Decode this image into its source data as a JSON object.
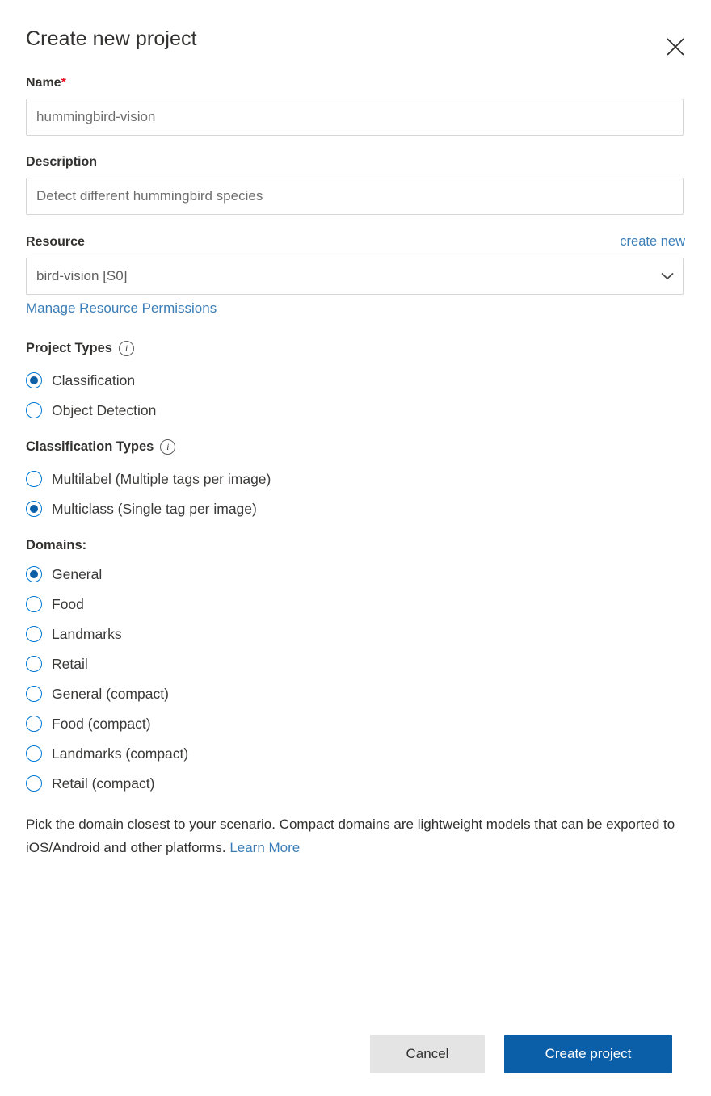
{
  "dialog": {
    "title": "Create new project",
    "close_icon": "close-icon"
  },
  "name_field": {
    "label": "Name",
    "required_marker": "*",
    "value": "hummingbird-vision",
    "placeholder": "hummingbird-vision"
  },
  "description_field": {
    "label": "Description",
    "value": "Detect different hummingbird species",
    "placeholder": "Detect different hummingbird species"
  },
  "resource": {
    "label": "Resource",
    "create_new_label": "create new",
    "selected": "bird-vision [S0]",
    "options": [
      "bird-vision [S0]"
    ],
    "chevron_icon": "chevron-down-icon",
    "manage_permissions_label": "Manage Resource Permissions"
  },
  "project_types": {
    "title": "Project Types",
    "info_icon": "info-icon",
    "options": [
      {
        "label": "Classification",
        "selected": true
      },
      {
        "label": "Object Detection",
        "selected": false
      }
    ]
  },
  "classification_types": {
    "title": "Classification Types",
    "info_icon": "info-icon",
    "options": [
      {
        "label": "Multilabel (Multiple tags per image)",
        "selected": false
      },
      {
        "label": "Multiclass (Single tag per image)",
        "selected": true
      }
    ]
  },
  "domains": {
    "title": "Domains:",
    "options": [
      {
        "label": "General",
        "selected": true
      },
      {
        "label": "Food",
        "selected": false
      },
      {
        "label": "Landmarks",
        "selected": false
      },
      {
        "label": "Retail",
        "selected": false
      },
      {
        "label": "General (compact)",
        "selected": false
      },
      {
        "label": "Food (compact)",
        "selected": false
      },
      {
        "label": "Landmarks (compact)",
        "selected": false
      },
      {
        "label": "Retail (compact)",
        "selected": false
      }
    ]
  },
  "help": {
    "text": "Pick the domain closest to your scenario. Compact domains are lightweight models that can be exported to iOS/Android and other platforms.",
    "link_label": "Learn More"
  },
  "footer": {
    "cancel_label": "Cancel",
    "submit_label": "Create project"
  },
  "colors": {
    "accent_blue": "#0b5fa8",
    "radio_ring": "#0078d4",
    "link_blue": "#3b7eb8",
    "required_red": "#e81123",
    "secondary_button_bg": "#e4e4e4",
    "input_border": "#d6d6d6",
    "text_primary": "#323130",
    "text_muted": "#6e6e6e"
  }
}
